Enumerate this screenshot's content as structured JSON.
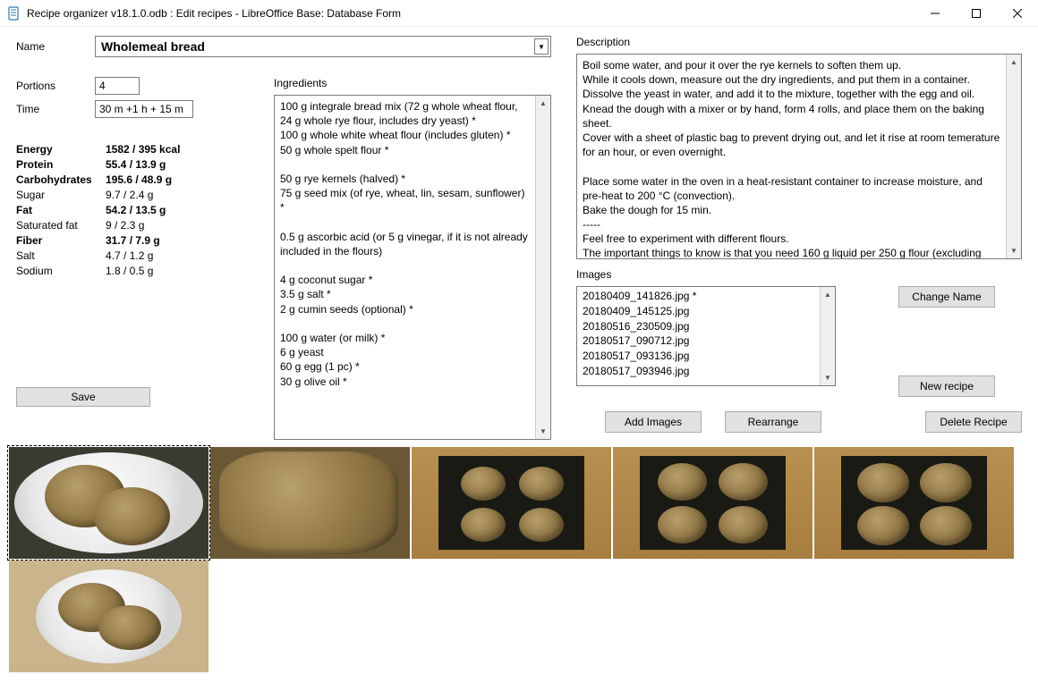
{
  "window": {
    "title": "Recipe organizer v18.1.0.odb : Edit recipes - LibreOffice Base: Database Form"
  },
  "labels": {
    "name": "Name",
    "portions": "Portions",
    "time": "Time",
    "ingredients": "Ingredients",
    "description": "Description",
    "images": "Images"
  },
  "recipe": {
    "name": "Wholemeal bread",
    "portions": "4",
    "time": "30 m +1 h + 15 m"
  },
  "nutrition": [
    {
      "key": "Energy",
      "val": "1582 / 395 kcal",
      "bold": true
    },
    {
      "key": "Protein",
      "val": "55.4 / 13.9 g",
      "bold": true
    },
    {
      "key": "Carbohydrates",
      "val": "195.6 / 48.9 g",
      "bold": true
    },
    {
      "key": "Sugar",
      "val": "9.7 / 2.4 g",
      "bold": false
    },
    {
      "key": "Fat",
      "val": "54.2 / 13.5 g",
      "bold": true
    },
    {
      "key": "Saturated fat",
      "val": "9 / 2.3 g",
      "bold": false
    },
    {
      "key": "Fiber",
      "val": "31.7 / 7.9 g",
      "bold": true
    },
    {
      "key": "Salt",
      "val": "4.7 / 1.2 g",
      "bold": false
    },
    {
      "key": "Sodium",
      "val": "1.8 / 0.5 g",
      "bold": false
    }
  ],
  "ingredients_text": "100 g integrale bread mix (72 g whole wheat flour, 24 g whole rye flour, includes dry yeast) *\n100 g whole white wheat flour (includes gluten) *\n50 g whole spelt flour *\n\n50 g rye kernels (halved) *\n75 g seed mix (of rye, wheat, lin, sesam, sunflower) *\n\n0.5 g ascorbic acid (or 5 g vinegar, if it is not already included in the flours)\n\n4 g coconut sugar *\n3.5 g salt *\n2 g cumin seeds (optional) *\n\n100 g water (or milk) *\n6 g yeast\n60 g egg (1 pc) *\n30 g olive oil *",
  "description_text": "Boil some water, and pour it over the rye kernels to soften them up.\nWhile it cools down, measure out the dry ingredients, and put them in a container.\nDissolve the yeast in water, and add it to the mixture, together with the egg and oil.\nKnead the dough with a mixer or by hand, form 4 rolls, and place them on the baking sheet.\nCover with a sheet of plastic bag to prevent drying out, and let it rise at room temerature for an hour, or even overnight.\n\nPlace some water in the oven in a heat-resistant container to increase moisture, and pre-heat to 200 °C (convection).\nBake the dough for 15 min.\n-----\nFeel free to experiment with different flours.\nThe important things to know is that you need 160 g liquid per 250 g flour (excluding",
  "image_files": [
    "20180409_141826.jpg *",
    "20180409_145125.jpg",
    "20180516_230509.jpg",
    "20180517_090712.jpg",
    "20180517_093136.jpg",
    "20180517_093946.jpg"
  ],
  "buttons": {
    "save": "Save",
    "change_name": "Change Name",
    "new_recipe": "New recipe",
    "delete_recipe": "Delete Recipe",
    "add_images": "Add Images",
    "rearrange": "Rearrange"
  }
}
